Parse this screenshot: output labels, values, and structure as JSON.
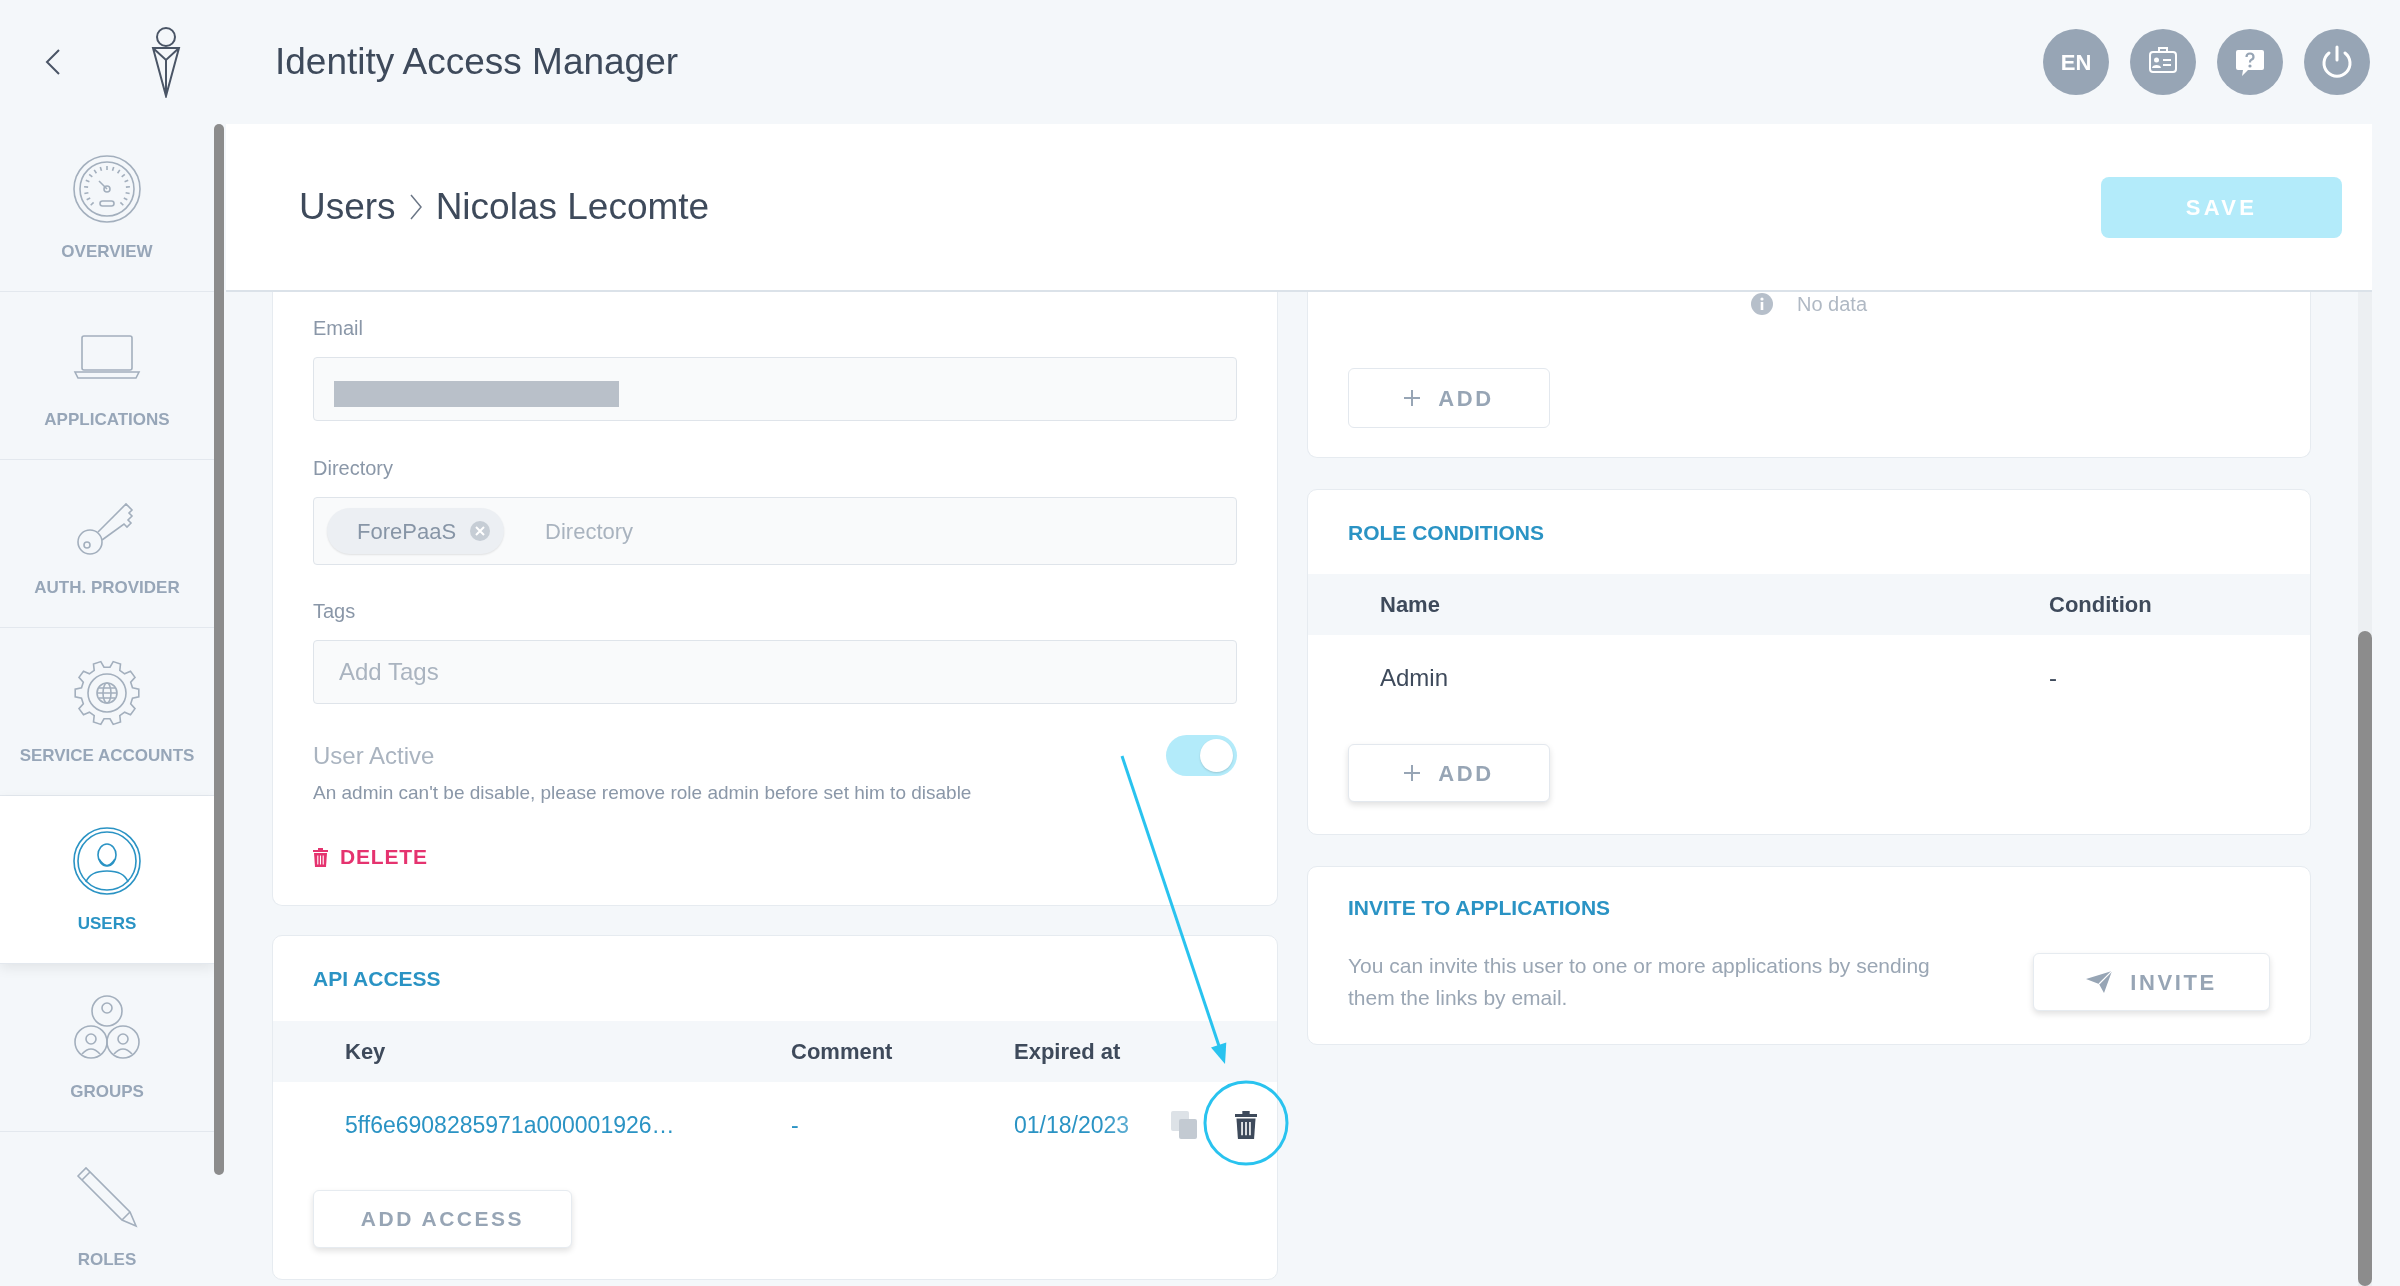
{
  "topbar": {
    "title": "Identity Access Manager",
    "language": "EN"
  },
  "sidebar": {
    "items": [
      {
        "label": "OVERVIEW",
        "selected": false
      },
      {
        "label": "APPLICATIONS",
        "selected": false
      },
      {
        "label": "AUTH. PROVIDER",
        "selected": false
      },
      {
        "label": "SERVICE ACCOUNTS",
        "selected": false
      },
      {
        "label": "USERS",
        "selected": true
      },
      {
        "label": "GROUPS",
        "selected": false
      },
      {
        "label": "ROLES",
        "selected": false
      }
    ]
  },
  "header": {
    "breadcrumb": [
      "Users",
      "Nicolas Lecomte"
    ],
    "save_button": {
      "label": "SAVE",
      "disabled": true
    }
  },
  "user_form": {
    "email": {
      "label": "Email",
      "redacted": true
    },
    "directory": {
      "label": "Directory",
      "chips": [
        "ForePaaS"
      ],
      "placeholder": "Directory"
    },
    "tags": {
      "label": "Tags",
      "placeholder": "Add Tags"
    },
    "user_active": {
      "label": "User Active",
      "on": true,
      "disabled": true,
      "hint": "An admin can't be disable, please remove role admin before set him to disable"
    },
    "delete_button": "DELETE"
  },
  "api_access": {
    "title": "API ACCESS",
    "columns": [
      "Key",
      "Comment",
      "Expired at"
    ],
    "rows": [
      {
        "key": "5ff6e6908285971a000001926…",
        "comment": "-",
        "expired_at": "01/18/2023"
      }
    ],
    "add_button": "ADD ACCESS"
  },
  "top_right_card": {
    "empty_text": "No data",
    "add_button": "ADD"
  },
  "role_conditions": {
    "title": "ROLE CONDITIONS",
    "columns": [
      "Name",
      "Condition"
    ],
    "rows": [
      {
        "name": "Admin",
        "condition": "-"
      }
    ],
    "add_button": "ADD"
  },
  "invite": {
    "title": "INVITE TO APPLICATIONS",
    "text": "You can invite this user to one or more applications by sending them the links by email.",
    "button": "INVITE"
  }
}
